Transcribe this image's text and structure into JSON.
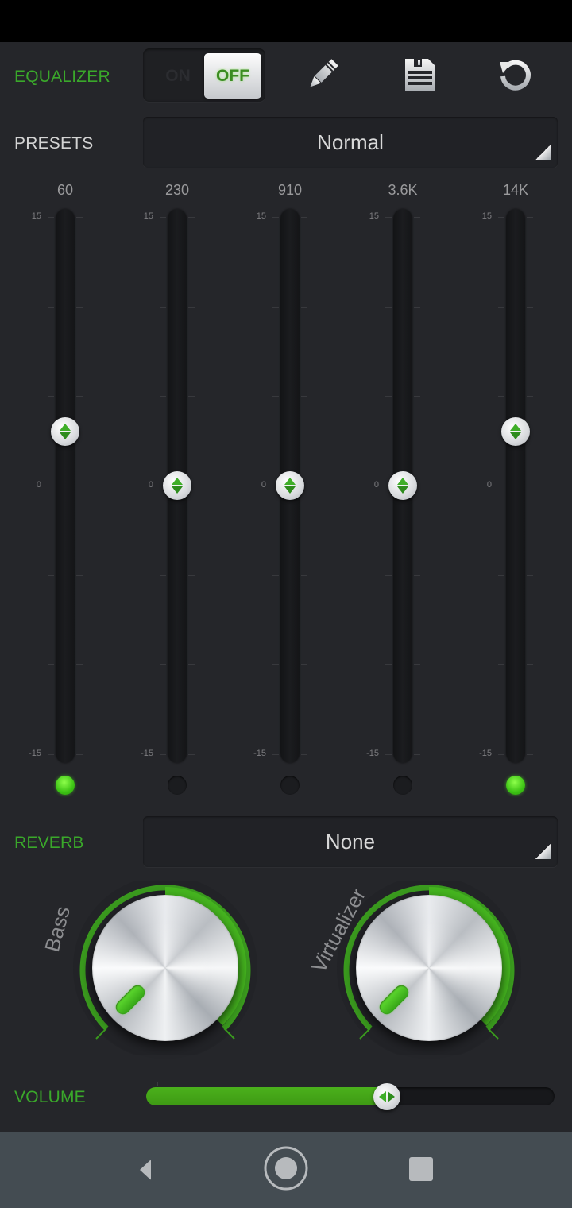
{
  "equalizer": {
    "label": "EQUALIZER",
    "toggle": {
      "on_label": "ON",
      "off_label": "OFF",
      "state": "off"
    },
    "toolbar": [
      {
        "name": "edit",
        "icon": "pencil-icon"
      },
      {
        "name": "save",
        "icon": "floppy-disk-icon"
      },
      {
        "name": "reset",
        "icon": "reset-icon"
      }
    ]
  },
  "presets": {
    "label": "PRESETS",
    "value": "Normal"
  },
  "eq_scale": {
    "max_label": "15",
    "mid_label": "0",
    "min_label": "-15",
    "max_db": 15,
    "min_db": -15
  },
  "bands": [
    {
      "freq": "60",
      "gain_db": 3,
      "indicator_on": true
    },
    {
      "freq": "230",
      "gain_db": 0,
      "indicator_on": false
    },
    {
      "freq": "910",
      "gain_db": 0,
      "indicator_on": false
    },
    {
      "freq": "3.6K",
      "gain_db": 0,
      "indicator_on": false
    },
    {
      "freq": "14K",
      "gain_db": 3,
      "indicator_on": true
    }
  ],
  "reverb": {
    "label": "REVERB",
    "value": "None"
  },
  "knobs": [
    {
      "label": "Bass",
      "value": 0
    },
    {
      "label": "Virtualizer",
      "value": 0
    }
  ],
  "volume": {
    "label": "VOLUME",
    "value_fraction": 0.59
  },
  "colors": {
    "accent": "#3aa82a",
    "accent_bright": "#4bb11c",
    "background": "#25262a",
    "nav_bar": "#444c52"
  },
  "nav": [
    {
      "name": "back",
      "icon": "back-triangle-icon"
    },
    {
      "name": "home",
      "icon": "home-circle-icon"
    },
    {
      "name": "recents",
      "icon": "recents-square-icon"
    }
  ]
}
